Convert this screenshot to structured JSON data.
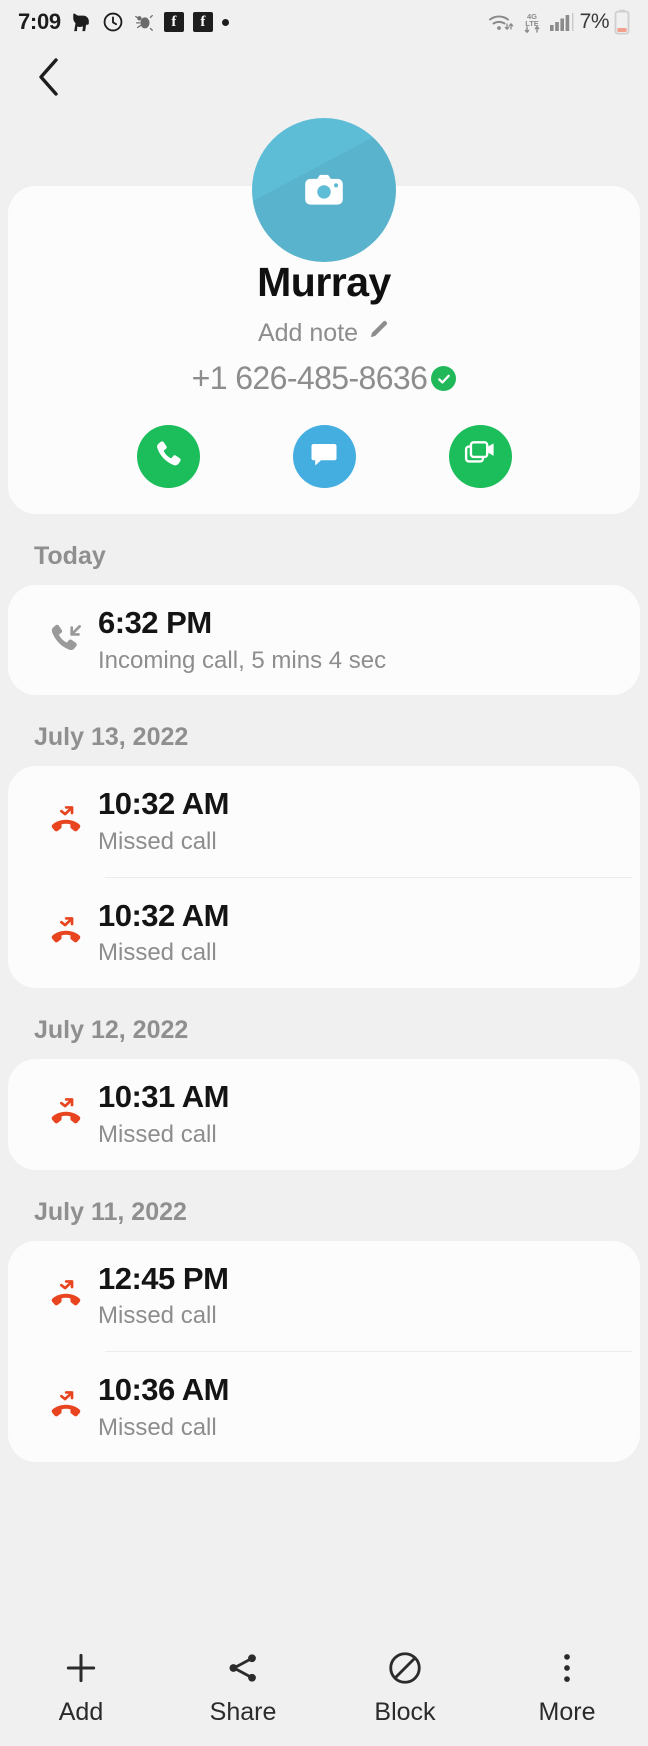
{
  "status_bar": {
    "time": "7:09",
    "battery_percent": "7%",
    "left_icons": [
      "dog-icon",
      "alarm-icon",
      "bug-icon",
      "facebook-icon",
      "facebook-icon",
      "dot-icon"
    ],
    "right_icons": [
      "wifi-icon",
      "data-transfer-icon",
      "signal-bars-icon",
      "battery-icon"
    ]
  },
  "nav": {
    "back_icon": "chevron-left-icon"
  },
  "profile": {
    "avatar_icon": "camera-icon",
    "avatar_color": "#5dbcd6",
    "name": "Murray",
    "note_label": "Add note",
    "note_icon": "pencil-icon",
    "phone_number": "+1 626-485-8636",
    "verified_icon": "verified-check-icon",
    "verified_color": "#21b85a",
    "actions": [
      {
        "name": "call-button",
        "icon": "phone-icon",
        "color": "#1cbd5b"
      },
      {
        "name": "message-button",
        "icon": "message-icon",
        "color": "#45aee0"
      },
      {
        "name": "video-button",
        "icon": "video-icon",
        "color": "#1cbd5b"
      }
    ]
  },
  "call_log": {
    "sections": [
      {
        "header": "Today",
        "entries": [
          {
            "time": "6:32 PM",
            "description": "Incoming call, 5 mins 4 sec",
            "type": "incoming",
            "icon": "incoming-call-icon",
            "color": "#9a9a9a"
          }
        ]
      },
      {
        "header": "July 13, 2022",
        "entries": [
          {
            "time": "10:32 AM",
            "description": "Missed call",
            "type": "missed",
            "icon": "missed-call-icon",
            "color": "#e8441f"
          },
          {
            "time": "10:32 AM",
            "description": "Missed call",
            "type": "missed",
            "icon": "missed-call-icon",
            "color": "#e8441f"
          }
        ]
      },
      {
        "header": "July 12, 2022",
        "entries": [
          {
            "time": "10:31 AM",
            "description": "Missed call",
            "type": "missed",
            "icon": "missed-call-icon",
            "color": "#e8441f"
          }
        ]
      },
      {
        "header": "July 11, 2022",
        "entries": [
          {
            "time": "12:45 PM",
            "description": "Missed call",
            "type": "missed",
            "icon": "missed-call-icon",
            "color": "#e8441f"
          },
          {
            "time": "10:36 AM",
            "description": "Missed call",
            "type": "missed",
            "icon": "missed-call-icon",
            "color": "#e8441f"
          }
        ]
      }
    ]
  },
  "bottom_bar": {
    "items": [
      {
        "label": "Add",
        "icon": "plus-icon"
      },
      {
        "label": "Share",
        "icon": "share-icon"
      },
      {
        "label": "Block",
        "icon": "block-icon"
      },
      {
        "label": "More",
        "icon": "more-vertical-icon"
      }
    ]
  }
}
